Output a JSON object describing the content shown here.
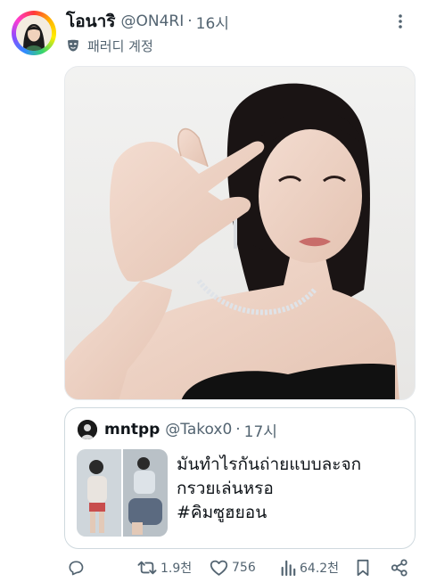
{
  "tweet": {
    "display_name": "โอนาริ",
    "handle": "@ON4RI",
    "separator": "·",
    "time": "16시",
    "parody_label": "패러디 계정"
  },
  "quote": {
    "display_name": "mntpp",
    "handle": "@Takox0",
    "separator": "·",
    "time": "17시",
    "text_lines": [
      "มันทำไรกันถ่ายแบบละจก",
      "กรวยเล่นหรอ"
    ],
    "hashtag": "#คิมซูฮยอน"
  },
  "actions": {
    "retweets": "1.9천",
    "likes": "756",
    "views": "64.2천"
  },
  "icons": {
    "more": "more-icon",
    "parody": "parody-mask-icon",
    "reply": "reply-icon",
    "retweet": "retweet-icon",
    "like": "heart-icon",
    "views": "views-icon",
    "bookmark": "bookmark-icon",
    "share": "share-icon"
  },
  "colors": {
    "text": "#0f1419",
    "muted": "#536471",
    "border": "#cfd9de"
  }
}
